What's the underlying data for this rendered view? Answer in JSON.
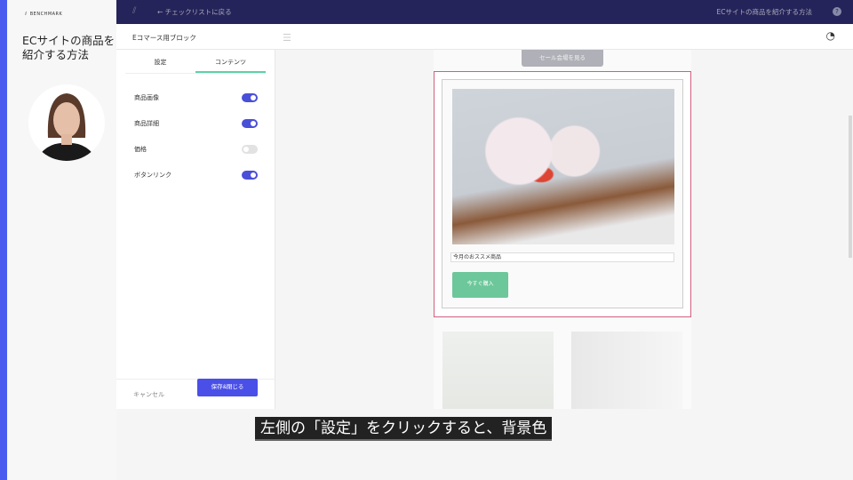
{
  "video": {
    "brand": "BENCHMARK",
    "title": "ECサイトの商品を紹介する方法",
    "subtitle": "左側の「設定」をクリックすると、背景色"
  },
  "topbar": {
    "back_label": "チェックリストに戻る",
    "page_title": "ECサイトの商品を紹介する方法",
    "help": "?"
  },
  "subbar": {
    "title": "Eコマース用ブロック"
  },
  "panel": {
    "tabs": [
      {
        "label": "設定",
        "active": false
      },
      {
        "label": "コンテンツ",
        "active": true
      }
    ],
    "toggles": [
      {
        "label": "商品画像",
        "on": true
      },
      {
        "label": "商品詳細",
        "on": true
      },
      {
        "label": "価格",
        "on": false
      },
      {
        "label": "ボタンリンク",
        "on": true
      }
    ],
    "cancel": "キャンセル",
    "save": "保存&閉じる"
  },
  "canvas": {
    "sale_button": "セール会場を見る",
    "caption": "今月のおススメ商品",
    "buy_button": "今すぐ購入"
  },
  "colors": {
    "topbar": "#25245a",
    "primary": "#4a4fe8",
    "toggle_on": "#4a4fd8",
    "buy": "#6cc79a",
    "selection": "#d06080",
    "tab_underline": "#5fd0a8"
  }
}
